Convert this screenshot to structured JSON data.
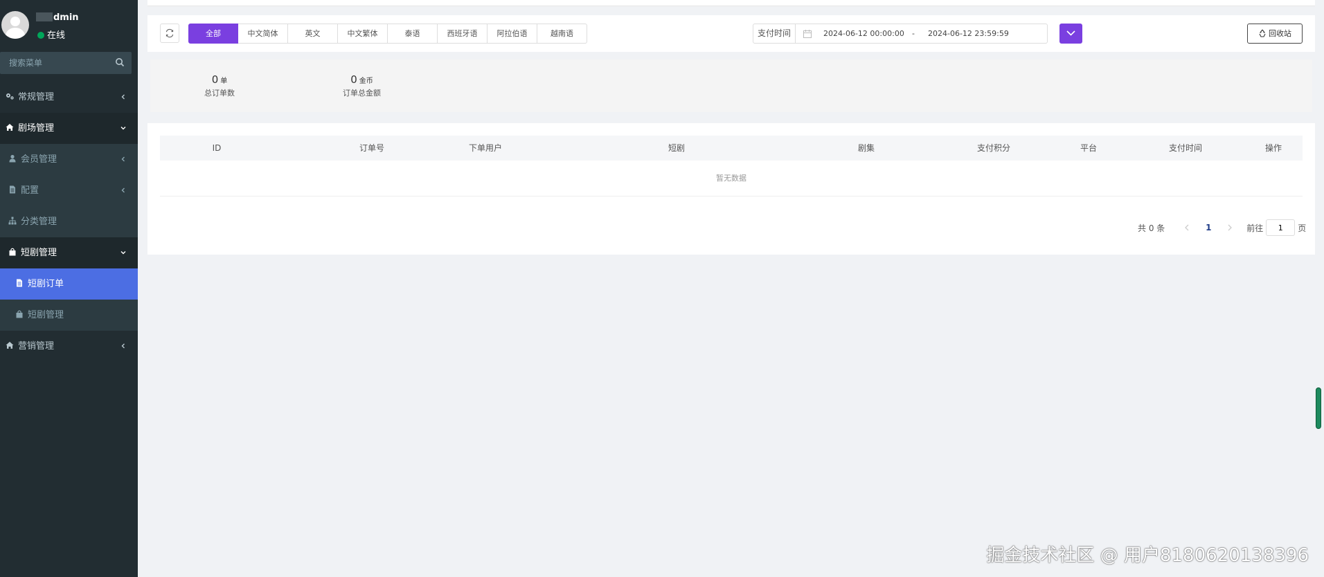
{
  "user": {
    "name": "dmin",
    "status": "在线"
  },
  "search": {
    "placeholder": "搜索菜单"
  },
  "menu": {
    "general": "常规管理",
    "venue": "剧场管理",
    "members": "会员管理",
    "config": "配置",
    "category": "分类管理",
    "short_drama": "短剧管理",
    "drama_orders": "短剧订单",
    "drama_manage": "短剧管理",
    "marketing": "营销管理"
  },
  "toolbar": {
    "tabs": [
      "全部",
      "中文简体",
      "英文",
      "中文繁体",
      "泰语",
      "西班牙语",
      "阿拉伯语",
      "越南语"
    ],
    "date_label": "支付时间",
    "date_start": "2024-06-12 00:00:00",
    "date_sep": "-",
    "date_end": "2024-06-12 23:59:59",
    "recycle": "回收站"
  },
  "stats": {
    "orders_num": "0",
    "orders_unit": "单",
    "orders_label": "总订单数",
    "amount_num": "0",
    "amount_unit": "金币",
    "amount_label": "订单总金额"
  },
  "table": {
    "columns": [
      "ID",
      "订单号",
      "下单用户",
      "短剧",
      "剧集",
      "支付积分",
      "平台",
      "支付时间",
      "操作"
    ],
    "empty": "暂无数据"
  },
  "pagination": {
    "total": "共 0 条",
    "current": "1",
    "goto": "前往",
    "goto_value": "1",
    "page_suffix": "页"
  },
  "watermark": "掘金技术社区 @ 用户8180620138396",
  "colors": {
    "sidebar": "#222d32",
    "accent": "#7a3fe0",
    "active_menu": "#4c6ee3",
    "online": "#00a65a"
  }
}
